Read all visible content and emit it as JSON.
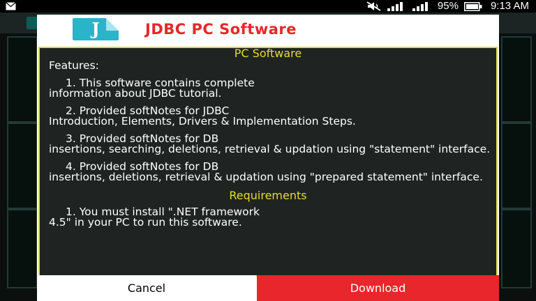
{
  "status_bar": {
    "notification_icon": "mail-icon",
    "battery_percent": "95%",
    "time": "9:13 AM",
    "icons": [
      "mute-icon",
      "signal-icon",
      "signal-icon",
      "battery-icon"
    ]
  },
  "dialog": {
    "title": "JDBC PC Software",
    "app_icon_letter": "J",
    "title_color": "#e8262b",
    "content": {
      "heading": "PC Software",
      "features_label": "Features:",
      "features": [
        {
          "first": "1. This software contains complete",
          "rest": "information about JDBC tutorial."
        },
        {
          "first": "2. Provided softNotes for JDBC",
          "rest": "Introduction, Elements, Drivers & Implementation Steps."
        },
        {
          "first": "3. Provided softNotes for DB",
          "rest": "insertions, searching, deletions, retrieval & updation using \"statement\" interface."
        },
        {
          "first": "4. Provided softNotes for DB",
          "rest": "insertions, deletions, retrieval & updation using \"prepared statement\" interface."
        }
      ],
      "requirements_heading": "Requirements",
      "requirements": [
        {
          "first": "1. You must install \".NET framework",
          "rest": "4.5\" in your PC to run this software."
        }
      ]
    },
    "buttons": {
      "cancel": "Cancel",
      "download": "Download",
      "download_color": "#e8262b"
    }
  }
}
